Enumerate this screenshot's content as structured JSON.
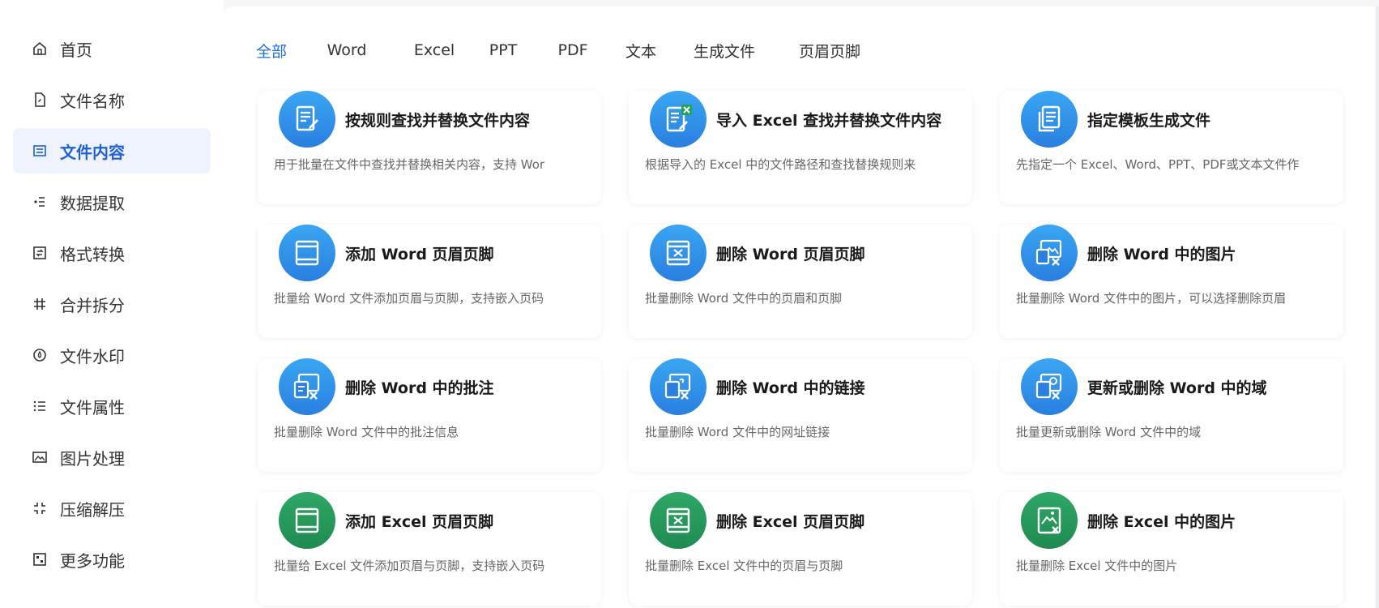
{
  "sidebar": {
    "items": [
      {
        "label": "首页",
        "icon": "home-icon"
      },
      {
        "label": "文件名称",
        "icon": "file-name-icon"
      },
      {
        "label": "文件内容",
        "icon": "file-content-icon",
        "active": true
      },
      {
        "label": "数据提取",
        "icon": "data-extract-icon"
      },
      {
        "label": "格式转换",
        "icon": "format-convert-icon"
      },
      {
        "label": "合并拆分",
        "icon": "merge-split-icon"
      },
      {
        "label": "文件水印",
        "icon": "watermark-icon"
      },
      {
        "label": "文件属性",
        "icon": "file-properties-icon"
      },
      {
        "label": "图片处理",
        "icon": "image-process-icon"
      },
      {
        "label": "压缩解压",
        "icon": "compress-icon"
      },
      {
        "label": "更多功能",
        "icon": "more-features-icon"
      }
    ]
  },
  "tabs": [
    "全部",
    "Word",
    "Excel",
    "PPT",
    "PDF",
    "文本",
    "生成文件",
    "页眉页脚"
  ],
  "active_tab": "全部",
  "cards": [
    {
      "title": "按规则查找并替换文件内容",
      "desc": "用于批量在文件中查找并替换相关内容，支持 Wor",
      "color": "blue",
      "icon": "document-edit-icon"
    },
    {
      "title": "导入 Excel 查找并替换文件内容",
      "desc": "根据导入的 Excel 中的文件路径和查找替换规则来",
      "color": "blue",
      "icon": "excel-import-icon"
    },
    {
      "title": "指定模板生成文件",
      "desc": "先指定一个 Excel、Word、PPT、PDF或文本文件作",
      "color": "blue",
      "icon": "template-copy-icon"
    },
    {
      "title": "添加 Word 页眉页脚",
      "desc": "批量给 Word 文件添加页眉与页脚，支持嵌入页码",
      "color": "blue",
      "icon": "header-footer-add-icon"
    },
    {
      "title": "删除 Word 页眉页脚",
      "desc": "批量删除 Word 文件中的页眉和页脚",
      "color": "blue",
      "icon": "header-footer-delete-icon"
    },
    {
      "title": "删除 Word 中的图片",
      "desc": "批量删除 Word 文件中的图片，可以选择删除页眉",
      "color": "blue",
      "icon": "image-delete-icon"
    },
    {
      "title": "删除 Word 中的批注",
      "desc": "批量删除 Word 文件中的批注信息",
      "color": "blue",
      "icon": "comment-delete-icon"
    },
    {
      "title": "删除 Word 中的链接",
      "desc": "批量删除 Word 文件中的网址链接",
      "color": "blue",
      "icon": "link-delete-icon"
    },
    {
      "title": "更新或删除 Word 中的域",
      "desc": "批量更新或删除 Word 文件中的域",
      "color": "blue",
      "icon": "field-update-icon"
    },
    {
      "title": "添加 Excel 页眉页脚",
      "desc": "批量给 Excel 文件添加页眉与页脚，支持嵌入页码",
      "color": "green",
      "icon": "excel-header-footer-add-icon"
    },
    {
      "title": "删除 Excel 页眉页脚",
      "desc": "批量删除 Excel 文件中的页眉与页脚",
      "color": "green",
      "icon": "excel-header-footer-delete-icon"
    },
    {
      "title": "删除 Excel 中的图片",
      "desc": "批量删除 Excel 文件中的图片",
      "color": "green",
      "icon": "excel-image-delete-icon"
    }
  ],
  "colors": {
    "accent": "#1f6fe0",
    "word_blue": "#2a7fe0",
    "excel_green": "#1f8a50",
    "active_bg": "#eef3fd"
  }
}
